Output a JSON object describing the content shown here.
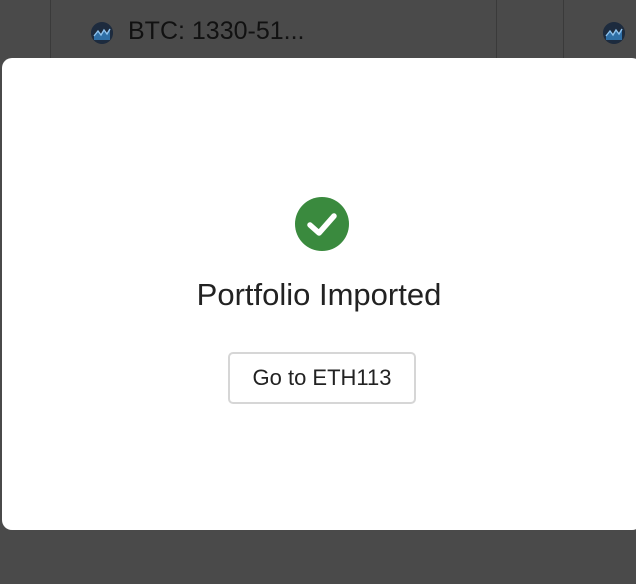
{
  "background": {
    "row_label": "BTC: 1330-51...",
    "icon": "coin-chart-icon"
  },
  "modal": {
    "status_icon": "check-circle-icon",
    "title": "Portfolio Imported",
    "button_label": "Go to ETH113",
    "accent_color": "#3a8a3e"
  }
}
